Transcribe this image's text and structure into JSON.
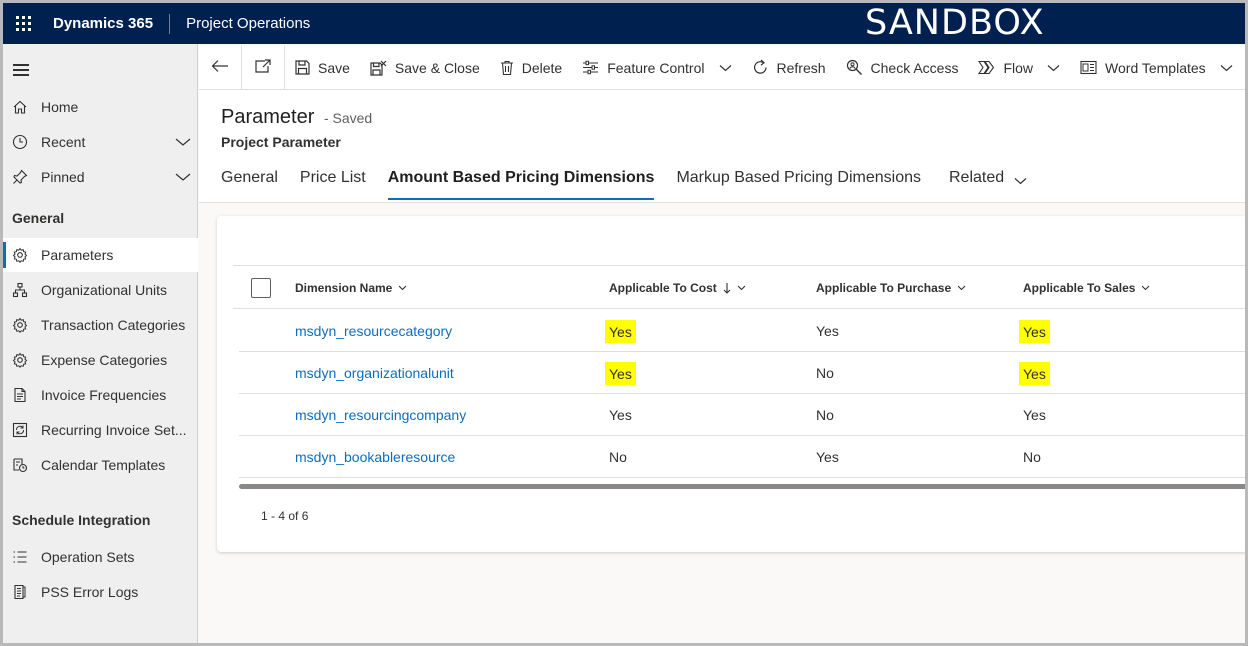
{
  "topbar": {
    "brand": "Dynamics 365",
    "app_name": "Project Operations",
    "environment_label": "SANDBOX"
  },
  "sidebar": {
    "items": [
      {
        "label": "Home",
        "icon": "home-icon"
      },
      {
        "label": "Recent",
        "icon": "clock-icon"
      },
      {
        "label": "Pinned",
        "icon": "pin-icon"
      }
    ],
    "general_heading": "General",
    "general_items": [
      {
        "label": "Parameters",
        "icon": "gear-icon",
        "active": true
      },
      {
        "label": "Organizational Units",
        "icon": "org-chart-icon"
      },
      {
        "label": "Transaction Categories",
        "icon": "gear-icon"
      },
      {
        "label": "Expense Categories",
        "icon": "gear-icon"
      },
      {
        "label": "Invoice Frequencies",
        "icon": "document-icon"
      },
      {
        "label": "Recurring Invoice Set...",
        "icon": "recurring-icon"
      },
      {
        "label": "Calendar Templates",
        "icon": "calendar-icon"
      }
    ],
    "schedule_heading": "Schedule Integration",
    "schedule_items": [
      {
        "label": "Operation Sets",
        "icon": "list-icon"
      },
      {
        "label": "PSS Error Logs",
        "icon": "log-icon"
      }
    ]
  },
  "commands": {
    "save": "Save",
    "save_close": "Save & Close",
    "delete": "Delete",
    "feature_control": "Feature Control",
    "refresh": "Refresh",
    "check_access": "Check Access",
    "flow": "Flow",
    "word_templates": "Word Templates"
  },
  "header": {
    "title": "Parameter",
    "status": "- Saved",
    "subtitle": "Project Parameter"
  },
  "tabs": {
    "general": "General",
    "price_list": "Price List",
    "amount_based": "Amount Based Pricing Dimensions",
    "markup_based": "Markup Based Pricing Dimensions",
    "related": "Related"
  },
  "grid": {
    "columns": {
      "name": "Dimension Name",
      "cost": "Applicable To Cost",
      "purchase": "Applicable To Purchase",
      "sales": "Applicable To Sales"
    },
    "rows": [
      {
        "name": "msdyn_resourcecategory",
        "cost": "Yes",
        "purchase": "Yes",
        "sales": "Yes"
      },
      {
        "name": "msdyn_organizationalunit",
        "cost": "Yes",
        "purchase": "No",
        "sales": "Yes"
      },
      {
        "name": "msdyn_resourcingcompany",
        "cost": "Yes",
        "purchase": "No",
        "sales": "Yes"
      },
      {
        "name": "msdyn_bookableresource",
        "cost": "No",
        "purchase": "Yes",
        "sales": "No"
      }
    ],
    "pager": "1 - 4 of 6"
  },
  "colors": {
    "topbar_bg": "#002050",
    "accent": "#0f6cbd",
    "highlight": "#ffff00"
  }
}
